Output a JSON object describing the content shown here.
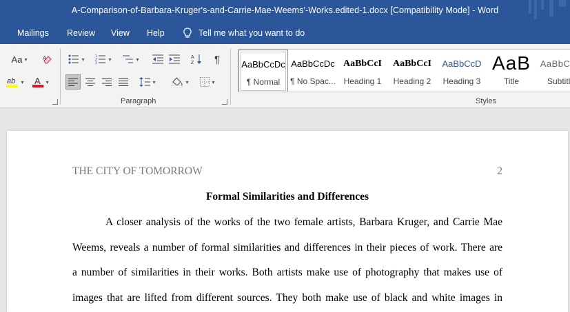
{
  "window": {
    "title": "A-Comparison-of-Barbara-Kruger's-and-Carrie-Mae-Weems'-Works.edited-1.docx [Compatibility Mode]  -  Word"
  },
  "ribbon_tabs": [
    "Mailings",
    "Review",
    "View",
    "Help"
  ],
  "tell_me": "Tell me what you want to do",
  "groups": {
    "paragraph": "Paragraph",
    "styles": "Styles"
  },
  "font_group": {
    "change_case": "Aa"
  },
  "styles": [
    {
      "sample": "AaBbCcDc",
      "name": "¶ Normal"
    },
    {
      "sample": "AaBbCcDc",
      "name": "¶ No Spac..."
    },
    {
      "sample": "AaBbCcI",
      "name": "Heading 1"
    },
    {
      "sample": "AaBbCcI",
      "name": "Heading 2"
    },
    {
      "sample": "AaBbCcD",
      "name": "Heading 3"
    },
    {
      "sample": "AaB",
      "name": "Title"
    },
    {
      "sample": "AaBbCcD",
      "name": "Subtitle"
    }
  ],
  "document": {
    "header_left": "THE CITY OF TOMORROW",
    "page_number": "2",
    "heading": "Formal Similarities and Differences",
    "lines": [
      "A closer analysis of the works of the two female artists, Barbara Kruger, and Carrie Mae",
      "Weems, reveals a number of formal similarities and differences in their pieces of work. There are",
      "a number of similarities in their works. Both artists make use of photography that makes use of",
      "images that are lifted from different sources. They both make use of black and white images in"
    ]
  },
  "colors": {
    "word_blue": "#2b579a",
    "ribbon_bg": "#f3f3f3",
    "heading3_blue": "#2f5496"
  }
}
